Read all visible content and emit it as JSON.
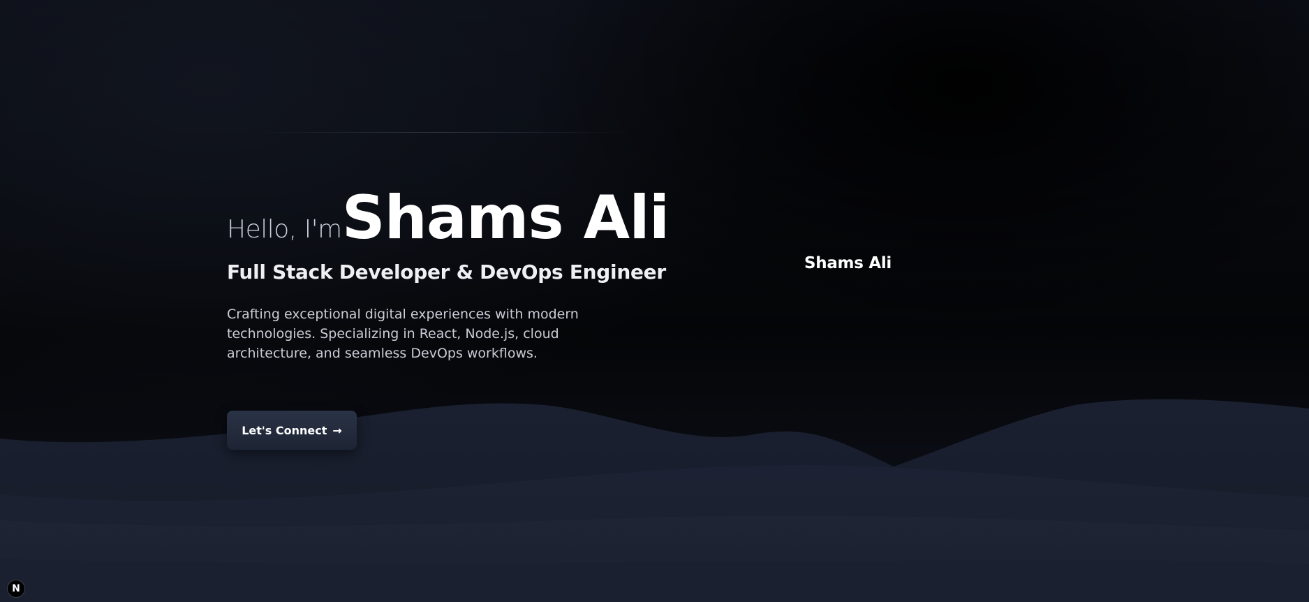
{
  "hero": {
    "greeting": "Hello, I'm",
    "name": "Shams Ali",
    "role": "Full Stack Developer & DevOps Engineer",
    "description": "Crafting exceptional digital experiences with modern technologies. Specializing in React, Node.js, cloud architecture, and seamless DevOps workflows.",
    "cta_label": "Let's Connect",
    "cta_arrow": "→"
  },
  "side": {
    "name": "Shams Ali"
  },
  "dev_badge": {
    "label": "N",
    "icon": "nextjs-icon"
  },
  "colors": {
    "background": "#05070c",
    "wave": "#1a2030",
    "button": "#232b3c",
    "text": "#ffffff",
    "muted_text": "#c9cdd6"
  }
}
